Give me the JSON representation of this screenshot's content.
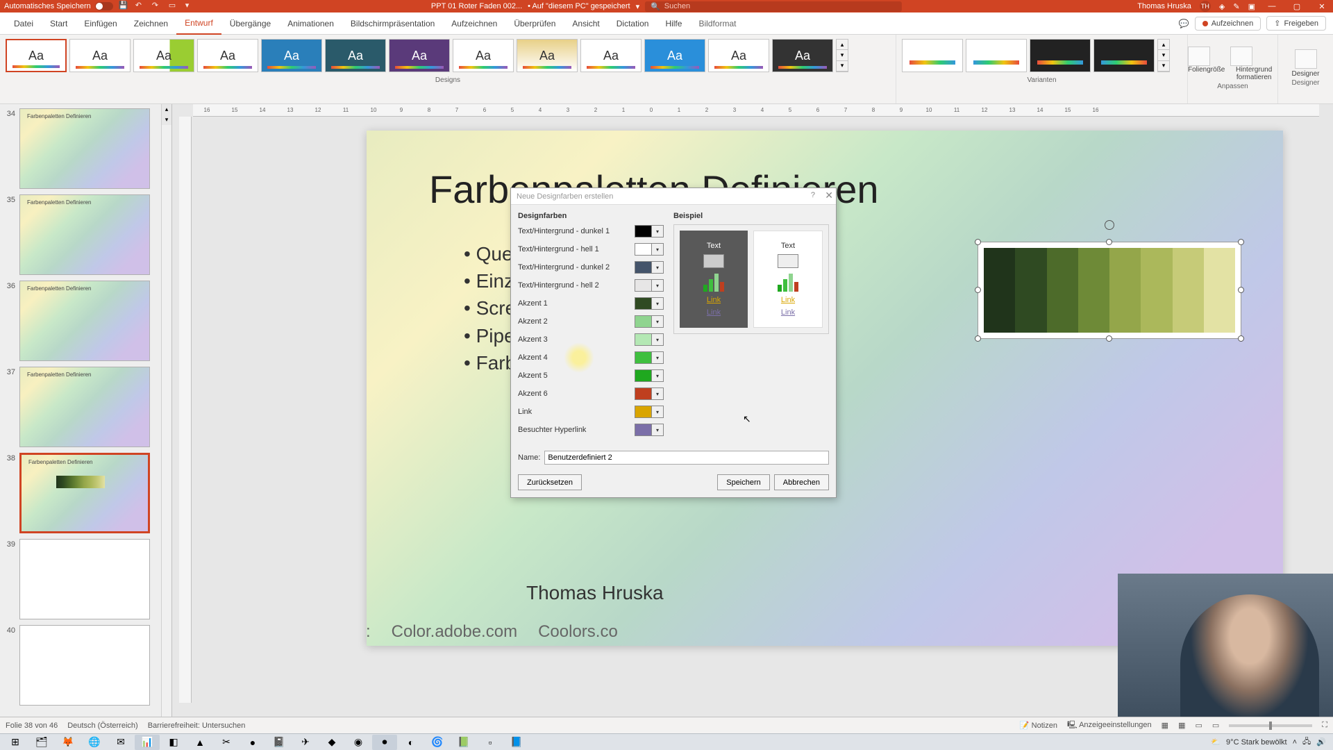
{
  "titlebar": {
    "autosave_label": "Automatisches Speichern",
    "doc_name": "PPT 01 Roter Faden 002...",
    "save_location_prefix": "• Auf \"diesem PC\" gespeichert",
    "search_placeholder": "Suchen",
    "user_name": "Thomas Hruska",
    "user_initials": "TH"
  },
  "ribbon": {
    "tabs": [
      "Datei",
      "Start",
      "Einfügen",
      "Zeichnen",
      "Entwurf",
      "Übergänge",
      "Animationen",
      "Bildschirmpräsentation",
      "Aufzeichnen",
      "Überprüfen",
      "Ansicht",
      "Dictation",
      "Hilfe",
      "Bildformat"
    ],
    "active_tab": "Entwurf",
    "record_label": "Aufzeichnen",
    "share_label": "Freigeben",
    "groups": {
      "designs": "Designs",
      "variants": "Varianten",
      "customize": "Anpassen",
      "designer": "Designer",
      "slide_size": "Foliengröße",
      "format_bg": "Hintergrund formatieren",
      "designer_btn": "Designer"
    }
  },
  "thumbnails": [
    {
      "num": "34",
      "title": "Farbenpaletten Definieren"
    },
    {
      "num": "35",
      "title": "Farbenpaletten Definieren"
    },
    {
      "num": "36",
      "title": "Farbenpaletten Definieren"
    },
    {
      "num": "37",
      "title": "Farbenpaletten Definieren"
    },
    {
      "num": "38",
      "title": "Farbenpaletten Definieren",
      "selected": true
    },
    {
      "num": "39",
      "title": ""
    },
    {
      "num": "40",
      "title": ""
    }
  ],
  "ruler_ticks": [
    "16",
    "15",
    "14",
    "13",
    "12",
    "11",
    "10",
    "9",
    "8",
    "7",
    "6",
    "5",
    "4",
    "3",
    "2",
    "1",
    "0",
    "1",
    "2",
    "3",
    "4",
    "5",
    "6",
    "7",
    "8",
    "9",
    "10",
    "11",
    "12",
    "13",
    "14",
    "15",
    "16"
  ],
  "slide": {
    "title": "Farbenpaletten Definieren",
    "list": [
      "Quellen",
      "Einzeln z",
      "Scre",
      "Pipe",
      "Farbpale"
    ],
    "author": "Thomas Hruska",
    "websites_label": "Webseiten:",
    "websites": [
      "Color.adobe.com",
      "Coolors.co"
    ],
    "palette_colors": [
      "#20341b",
      "#2f4a22",
      "#4d6b2a",
      "#6e8a37",
      "#94a64a",
      "#abb85b",
      "#c6cb78",
      "#e3e2a4"
    ]
  },
  "dialog": {
    "title": "Neue Designfarben erstellen",
    "left_header": "Designfarben",
    "right_header": "Beispiel",
    "rows": [
      {
        "label": "Text/Hintergrund - dunkel 1",
        "color": "#000000"
      },
      {
        "label": "Text/Hintergrund - hell 1",
        "color": "#ffffff"
      },
      {
        "label": "Text/Hintergrund - dunkel 2",
        "color": "#44546a"
      },
      {
        "label": "Text/Hintergrund - hell 2",
        "color": "#e7e6e6"
      },
      {
        "label": "Akzent 1",
        "color": "#2f4a22"
      },
      {
        "label": "Akzent 2",
        "color": "#8fd48f"
      },
      {
        "label": "Akzent 3",
        "color": "#b4e8b4"
      },
      {
        "label": "Akzent 4",
        "color": "#3fbf3f"
      },
      {
        "label": "Akzent 5",
        "color": "#1fa81f"
      },
      {
        "label": "Akzent 6",
        "color": "#bf3f1f"
      },
      {
        "label": "Link",
        "color": "#d9a500"
      },
      {
        "label": "Besuchter Hyperlink",
        "color": "#7b6fa8"
      }
    ],
    "preview_text": "Text",
    "preview_link": "Link",
    "name_label": "Name:",
    "name_value": "Benutzerdefiniert 2",
    "btn_reset": "Zurücksetzen",
    "btn_save": "Speichern",
    "btn_cancel": "Abbrechen"
  },
  "statusbar": {
    "slide_indicator": "Folie 38 von 46",
    "language": "Deutsch (Österreich)",
    "accessibility": "Barrierefreiheit: Untersuchen",
    "notes": "Notizen",
    "display_settings": "Anzeigeeinstellungen"
  },
  "taskbar": {
    "weather": "9°C  Stark bewölkt"
  }
}
